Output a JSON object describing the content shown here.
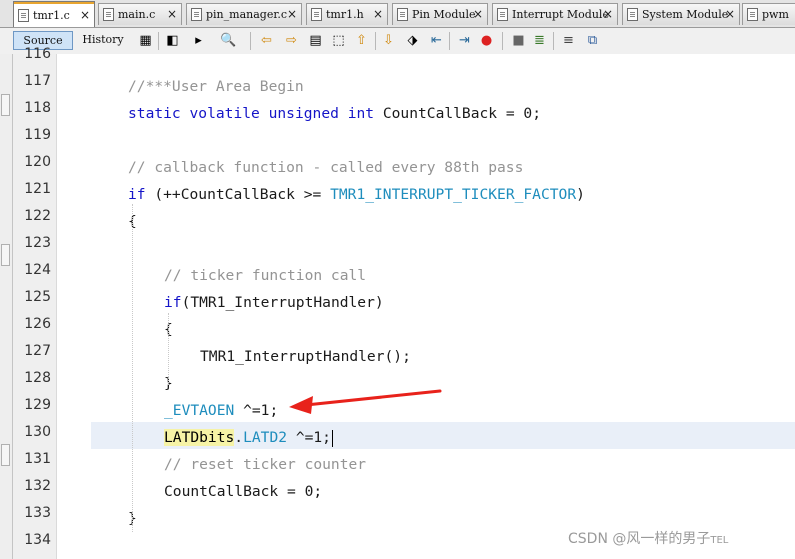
{
  "tabs": [
    {
      "label": "tmr1.c",
      "active": true
    },
    {
      "label": "main.c",
      "active": false
    },
    {
      "label": "pin_manager.c",
      "active": false
    },
    {
      "label": "tmr1.h",
      "active": false
    },
    {
      "label": "Pin Module",
      "active": false
    },
    {
      "label": "Interrupt Module",
      "active": false
    },
    {
      "label": "System Module",
      "active": false
    },
    {
      "label": "pwm",
      "active": false
    }
  ],
  "close_glyph": "×",
  "toolbar": {
    "source_label": "Source",
    "history_label": "History",
    "icons": [
      "last-edit-icon",
      "back-icon",
      "forward-icon",
      "find-icon",
      "find-previous-icon",
      "find-next-icon",
      "toggle-highlight-icon",
      "select-icon",
      "previous-bookmark-icon",
      "next-bookmark-icon",
      "toggle-bookmark-icon",
      "shift-left-icon",
      "shift-right-icon",
      "record-macro-icon",
      "stop-macro-icon",
      "comment-icon",
      "uncomment-icon",
      "diff-icon"
    ]
  },
  "line_numbers": [
    "116",
    "117",
    "118",
    "119",
    "120",
    "121",
    "122",
    "123",
    "124",
    "125",
    "126",
    "127",
    "128",
    "129",
    "130",
    "131",
    "132",
    "133",
    "134"
  ],
  "code_lines": [
    [],
    [
      {
        "t": "//***User Area Begin",
        "c": "cm"
      }
    ],
    [
      {
        "t": "static",
        "c": "kw"
      },
      {
        "t": " ",
        "c": "fn"
      },
      {
        "t": "volatile",
        "c": "kw"
      },
      {
        "t": " ",
        "c": "fn"
      },
      {
        "t": "unsigned",
        "c": "kw"
      },
      {
        "t": " ",
        "c": "fn"
      },
      {
        "t": "int",
        "c": "kw"
      },
      {
        "t": " CountCallBack = 0;",
        "c": "fn"
      }
    ],
    [],
    [
      {
        "t": "// callback function - called every 88th pass",
        "c": "cm"
      }
    ],
    [
      {
        "t": "if",
        "c": "kw"
      },
      {
        "t": " (++CountCallBack >= ",
        "c": "fn"
      },
      {
        "t": "TMR1_INTERRUPT_TICKER_FACTOR",
        "c": "mc"
      },
      {
        "t": ")",
        "c": "fn"
      }
    ],
    [
      {
        "t": "{",
        "c": "fn"
      }
    ],
    [],
    [
      {
        "t": "// ticker function call",
        "c": "cm"
      }
    ],
    [
      {
        "t": "if",
        "c": "kw"
      },
      {
        "t": "(TMR1_InterruptHandler)",
        "c": "fn"
      }
    ],
    [
      {
        "t": "{",
        "c": "fn"
      }
    ],
    [
      {
        "t": "TMR1_InterruptHandler();",
        "c": "fn"
      }
    ],
    [
      {
        "t": "}",
        "c": "fn"
      }
    ],
    [
      {
        "t": "_EVTAOEN",
        "c": "mc"
      },
      {
        "t": " ^=1;",
        "c": "fn"
      }
    ],
    [
      {
        "t": "LATDbits",
        "c": "mark"
      },
      {
        "t": ".",
        "c": "fn"
      },
      {
        "t": "LATD2",
        "c": "mc"
      },
      {
        "t": " ^=1;",
        "c": "fn"
      }
    ],
    [
      {
        "t": "// reset ticker counter",
        "c": "cm"
      }
    ],
    [
      {
        "t": "CountCallBack = 0;",
        "c": "fn"
      }
    ],
    [
      {
        "t": "}",
        "c": "fn"
      }
    ],
    []
  ],
  "indents": [
    0,
    1,
    1,
    0,
    1,
    1,
    1,
    0,
    2,
    2,
    2,
    3,
    2,
    2,
    2,
    2,
    2,
    1,
    0
  ],
  "annotation": {
    "color": "#e8221b"
  },
  "watermark": "CSDN @风一样的男子",
  "watermark_suffix": "TEL"
}
